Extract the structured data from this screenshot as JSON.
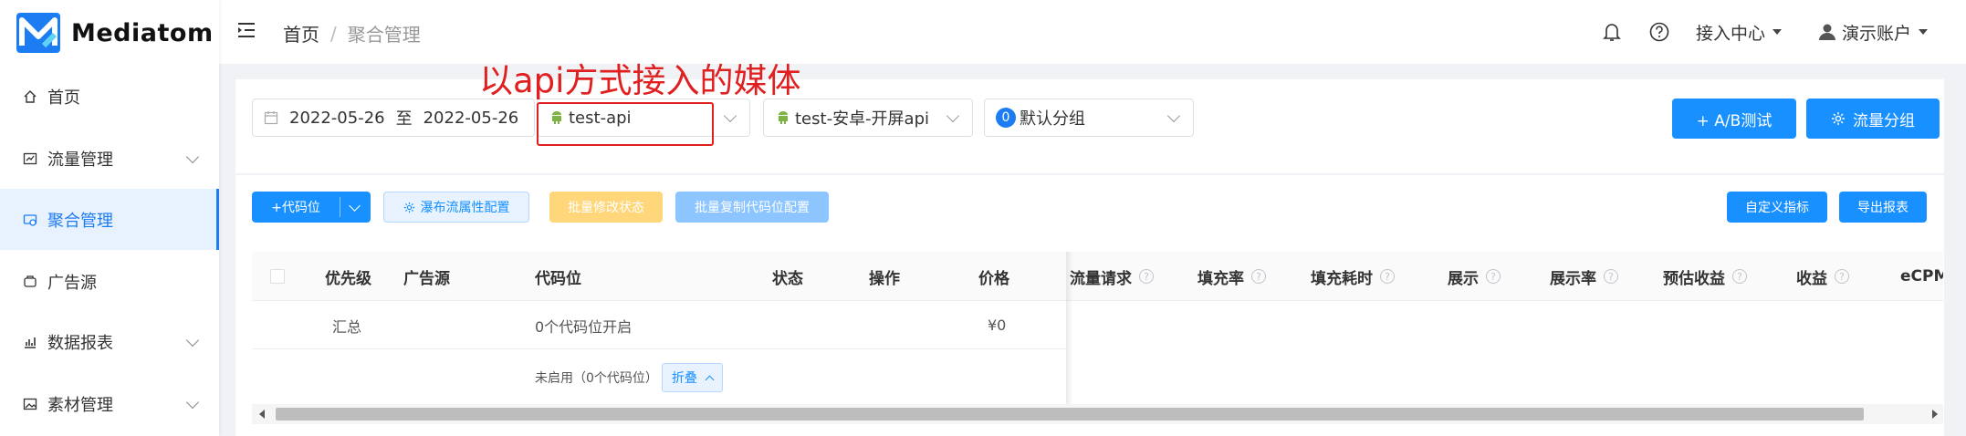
{
  "app": {
    "name": "Mediatom"
  },
  "sidebar": {
    "items": [
      {
        "label": "首页",
        "icon": "home-icon"
      },
      {
        "label": "流量管理",
        "icon": "traffic-icon"
      },
      {
        "label": "聚合管理",
        "icon": "aggregate-icon",
        "active": true
      },
      {
        "label": "广告源",
        "icon": "ad-source-icon"
      },
      {
        "label": "数据报表",
        "icon": "report-icon"
      },
      {
        "label": "素材管理",
        "icon": "material-icon"
      }
    ]
  },
  "header": {
    "breadcrumb": {
      "home": "首页",
      "separator": "/",
      "current": "聚合管理"
    },
    "access_center": "接入中心",
    "account": "演示账户"
  },
  "annotation": {
    "text": "以api方式接入的媒体",
    "color": "#e02020"
  },
  "filters": {
    "date_start": "2022-05-26",
    "date_to": "至",
    "date_end": "2022-05-26",
    "app_select": "test-api",
    "adspace_select": "test-安卓-开屏api",
    "group_badge": "0",
    "group_select": "默认分组",
    "ab_test_button": "+ A/B测试",
    "flow_group_button": "流量分组"
  },
  "toolbar": {
    "add_code_button": "+代码位",
    "flow_attr_button": "瀑布流属性配置",
    "batch_status_button": "批量修改状态",
    "batch_copy_button": "批量复制代码位配置",
    "custom_metrics_button": "自定义指标",
    "export_button": "导出报表"
  },
  "table": {
    "columns": [
      "优先级",
      "广告源",
      "代码位",
      "状态",
      "操作",
      "价格",
      "流量请求",
      "填充率",
      "填充耗时",
      "展示",
      "展示率",
      "预估收益",
      "收益",
      "eCPM"
    ],
    "summary_row": {
      "label": "汇总",
      "code": "0个代码位开启",
      "price": "¥0"
    },
    "disabled_row": {
      "text": "未启用（0个代码位）",
      "fold": "折叠"
    }
  },
  "colors": {
    "primary": "#1890ff",
    "active_menu": "#1c7df2",
    "warning_btn": "#ffd77a"
  }
}
